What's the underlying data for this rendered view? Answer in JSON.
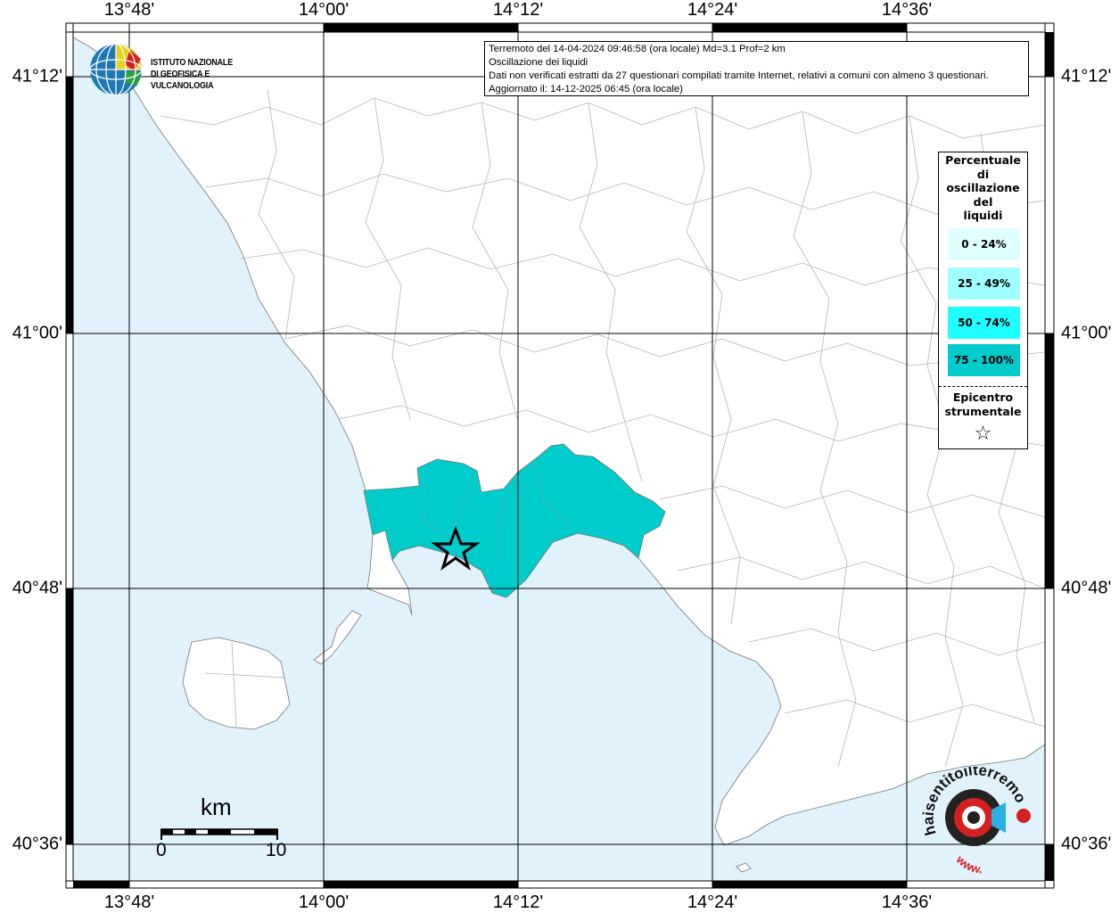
{
  "map": {
    "lon_labels": [
      "13°48'",
      "14°00'",
      "14°12'",
      "14°24'",
      "14°36'"
    ],
    "lat_labels": [
      "41°12'",
      "41°00'",
      "40°48'",
      "40°36'"
    ],
    "colors": {
      "sea": "#e0f2fc",
      "land": "#ffffff",
      "affected_area": "#00cccc",
      "border": "#b4b4b4",
      "grid": "#000000"
    }
  },
  "info": {
    "line1": "Terremoto del 14-04-2024 09:46:58 (ora locale) Md=3.1 Prof=2 km",
    "line2": "Oscillazione dei liquidi",
    "line3": "Dati non verificati estratti da 27 questionari compilati tramite Internet, relativi a comuni con almeno 3 questionari.",
    "line4": "Aggiornato il: 14-12-2025 06:45 (ora locale)"
  },
  "logo": {
    "line1": "ISTITUTO NAZIONALE",
    "line2": "DI GEOFISICA E VULCANOLOGIA"
  },
  "legend": {
    "title": [
      "Percentuale",
      "di",
      "oscillazione",
      "del",
      "liquidi"
    ],
    "items": [
      {
        "label": "0 - 24%",
        "color": "#e0ffff"
      },
      {
        "label": "25 - 49%",
        "color": "#a0ffff"
      },
      {
        "label": "50 - 74%",
        "color": "#20ffff"
      },
      {
        "label": "75 - 100%",
        "color": "#00cccc"
      }
    ],
    "epicenter_label": [
      "Epicentro",
      "strumentale"
    ]
  },
  "scale": {
    "unit": "km",
    "start": "0",
    "end": "10"
  },
  "badge": {
    "text": "haisentitoilterremoto.it",
    "url": "www.",
    "icon": "haisentito-logo-icon"
  }
}
